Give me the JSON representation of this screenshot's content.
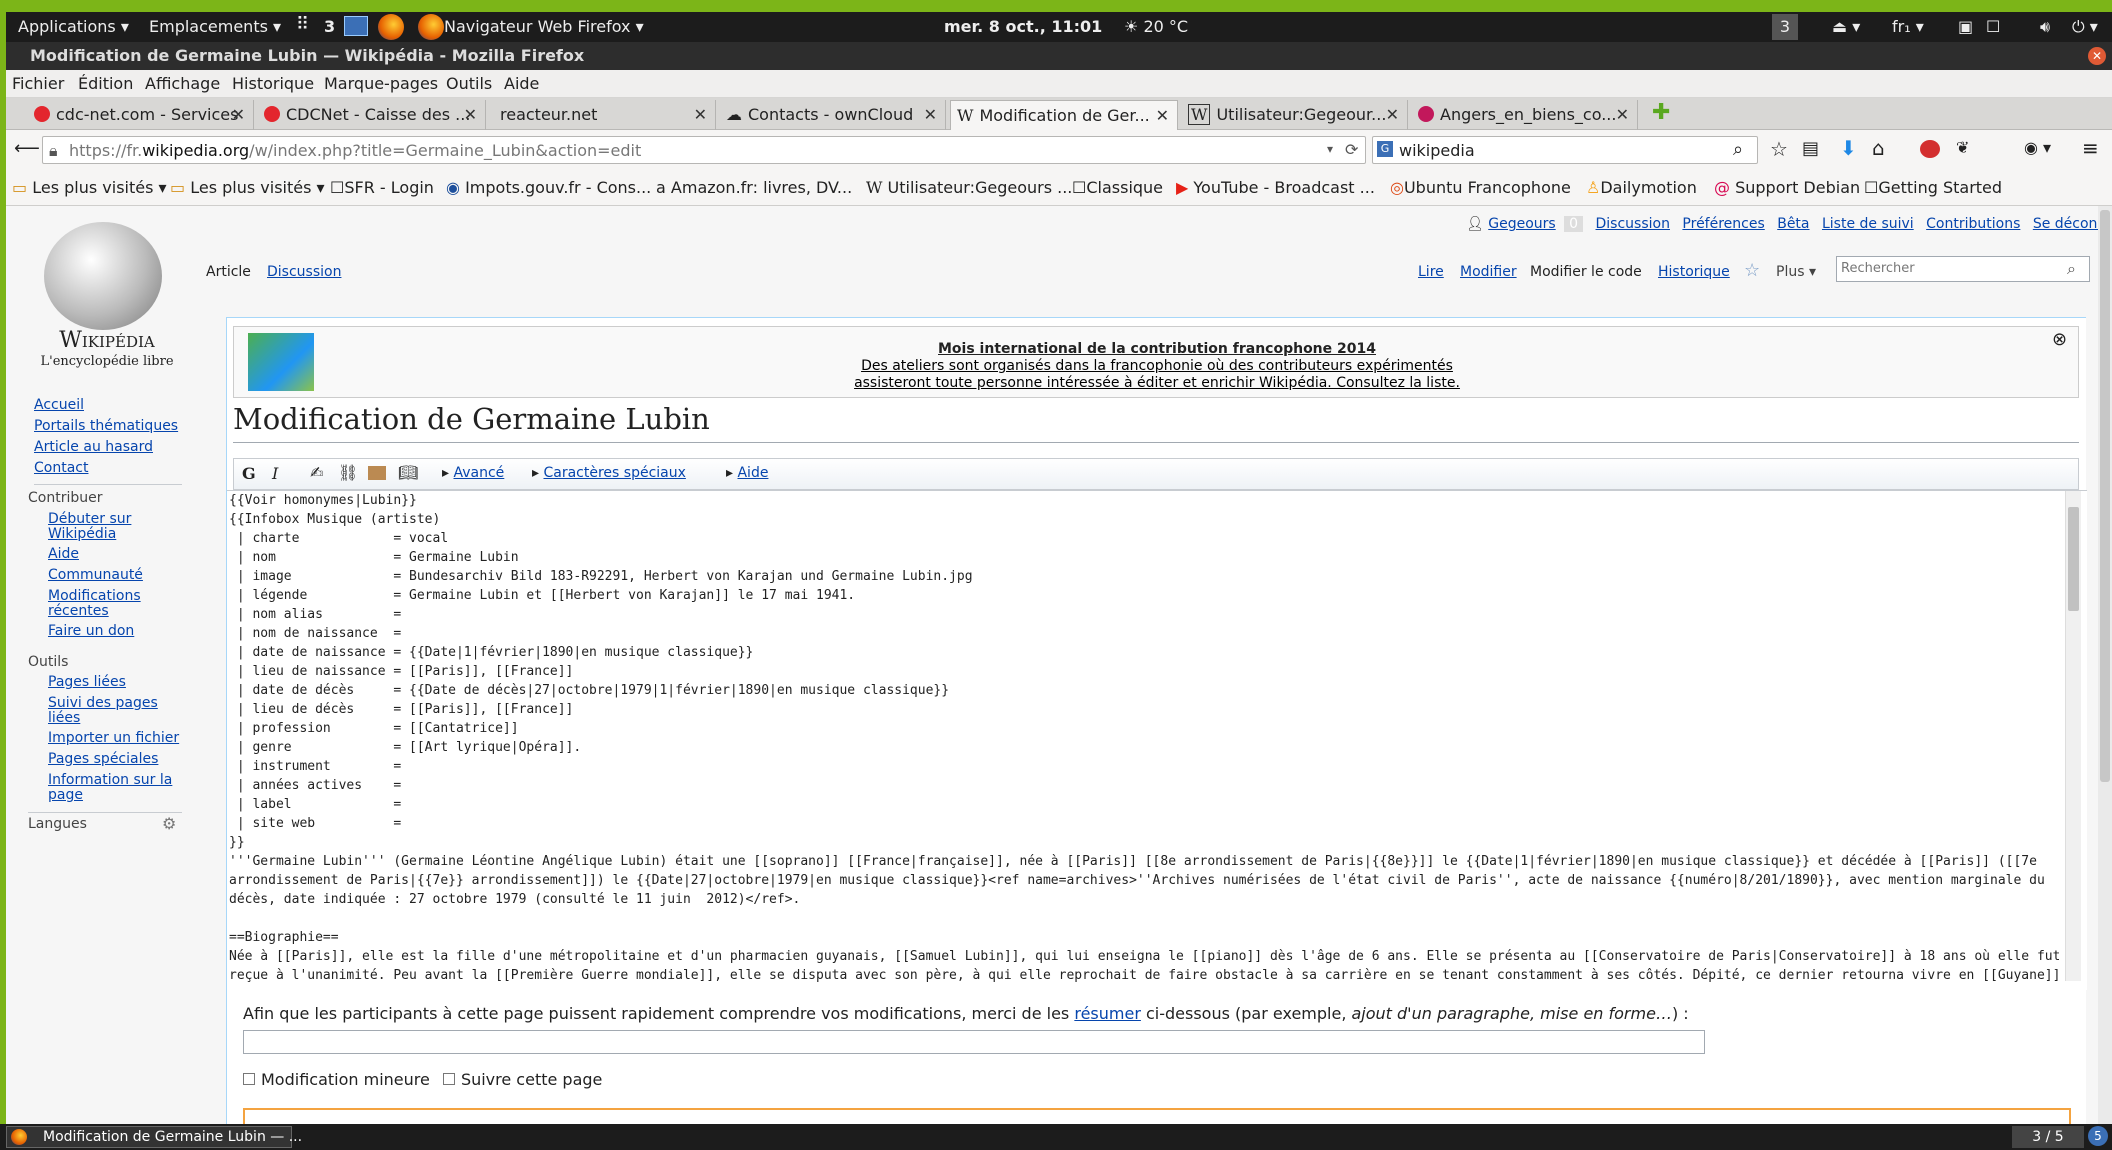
{
  "topbar": {
    "applications": "Applications",
    "places": "Emplacements",
    "workspace": "3",
    "active_app": "Navigateur Web Firefox",
    "clock": "mer.  8 oct., 11:01",
    "weather": "20 °C",
    "notif_count": "3",
    "keyboard": "fr₁"
  },
  "window": {
    "title": "Modification de Germaine Lubin — Wikipédia - Mozilla Firefox"
  },
  "menu": [
    "Fichier",
    "Édition",
    "Affichage",
    "Historique",
    "Marque-pages",
    "Outils",
    "Aide"
  ],
  "tabs": [
    {
      "label": "cdc-net.com - Services",
      "color": "#e3262d"
    },
    {
      "label": "CDCNet - Caisse des ...",
      "color": "#e3262d"
    },
    {
      "label": "reacteur.net",
      "color": ""
    },
    {
      "label": "Contacts - ownCloud",
      "color": "#1d2d44"
    },
    {
      "label": "Modification de Ger...",
      "color": ""
    },
    {
      "label": "Utilisateur:Gegeour...",
      "color": ""
    },
    {
      "label": "Angers_en_biens_co...",
      "color": "#c2185b"
    }
  ],
  "nav": {
    "url_prefix": "https://fr.",
    "url_domain": "wikipedia.org",
    "url_rest": "/w/index.php?title=Germaine_Lubin&action=edit",
    "search_value": "wikipedia"
  },
  "bookmarks": [
    "Les plus visités",
    "Les plus visités",
    "SFR - Login",
    "Impots.gouv.fr - Cons...",
    "Amazon.fr: livres, DV...",
    "Utilisateur:Gegeours ...",
    "Classique",
    "YouTube - Broadcast ...",
    "Ubuntu Francophone",
    "Dailymotion",
    "Support Debian",
    "Getting Started"
  ],
  "wiki": {
    "logo_name": "Wikipédia",
    "logo_tagline": "L'encyclopédie libre",
    "user_links": [
      "Gegeours",
      "0",
      "Discussion",
      "Préférences",
      "Bêta",
      "Liste de suivi",
      "Contributions",
      "Se déconnecter"
    ],
    "ns_tabs": [
      "Article",
      "Discussion"
    ],
    "view_tabs": [
      "Lire",
      "Modifier",
      "Modifier le code",
      "Historique"
    ],
    "more": "Plus",
    "search_placeholder": "Rechercher",
    "nav_links": [
      "Accueil",
      "Portails thématiques",
      "Article au hasard",
      "Contact"
    ],
    "contribute_title": "Contribuer",
    "contribute_links": [
      "Débuter sur Wikipédia",
      "Aide",
      "Communauté",
      "Modifications récentes",
      "Faire un don"
    ],
    "tools_title": "Outils",
    "tools_links": [
      "Pages liées",
      "Suivi des pages liées",
      "Importer un fichier",
      "Pages spéciales",
      "Information sur la page"
    ],
    "languages_title": "Langues",
    "banner_title": "Mois international de la contribution francophone 2014",
    "banner_line1": "Des ateliers sont organisés dans la francophonie où des contributeurs expérimentés",
    "banner_line2": "assisteront toute personne intéressée à éditer et enrichir Wikipédia. Consultez la liste.",
    "heading": "Modification de Germaine Lubin",
    "toolbar": {
      "bold": "G",
      "italic": "I",
      "advanced": "Avancé",
      "special_chars": "Caractères spéciaux",
      "help": "Aide"
    },
    "code": "{{Voir homonymes|Lubin}}\n{{Infobox Musique (artiste)\n | charte            = vocal\n | nom               = Germaine Lubin\n | image             = Bundesarchiv Bild 183-R92291, Herbert von Karajan und Germaine Lubin.jpg\n | légende           = Germaine Lubin et [[Herbert von Karajan]] le 17 mai 1941.\n | nom alias         = \n | nom de naissance  = \n | date de naissance = {{Date|1|février|1890|en musique classique}}\n | lieu de naissance = [[Paris]], [[France]]\n | date de décès     = {{Date de décès|27|octobre|1979|1|février|1890|en musique classique}}\n | lieu de décès     = [[Paris]], [[France]]\n | profession        = [[Cantatrice]]\n | genre             = [[Art lyrique|Opéra]].\n | instrument        = \n | années actives    = \n | label             = \n | site web          = \n}}\n'''Germaine Lubin''' (Germaine Léontine Angélique Lubin) était une [[soprano]] [[France|française]], née à [[Paris]] [[8e arrondissement de Paris|{{8e}}]] le {{Date|1|février|1890|en musique classique}} et décédée à [[Paris]] ([[7e\narrondissement de Paris|{{7e}} arrondissement]]) le {{Date|27|octobre|1979|en musique classique}}<ref name=archives>''Archives numérisées de l'état civil de Paris'', acte de naissance {{numéro|8/201/1890}}, avec mention marginale du\ndécès, date indiquée : 27 octobre 1979 (consulté le 11 juin  2012)</ref>.\n\n==Biographie==\nNée à [[Paris]], elle est la fille d'une métropolitaine et d'un pharmacien guyanais, [[Samuel Lubin]], qui lui enseigna le [[piano]] dès l'âge de 6 ans. Elle se présenta au [[Conservatoire de Paris|Conservatoire]] à 18 ans où elle fut\nreçue à l'unanimité. Peu avant la [[Première Guerre mondiale]], elle se disputa avec son père, à qui elle reprochait de faire obstacle à sa carrière en se tenant constamment à ses côtés. Dépité, ce dernier retourna vivre en [[Guyane]].",
    "summary_pre": "Afin que les participants à cette page puissent rapidement comprendre vos modifications, merci de les ",
    "summary_link": "résumer",
    "summary_mid": " ci-dessous (par exemple, ",
    "summary_example": "ajout d'un paragraphe, mise en forme…",
    "summary_post": ") :",
    "minor_edit": "Modification mineure",
    "watch_page": "Suivre cette page"
  },
  "taskbar": {
    "window": "Modification de Germaine Lubin — ...",
    "workspace": "3 / 5"
  }
}
